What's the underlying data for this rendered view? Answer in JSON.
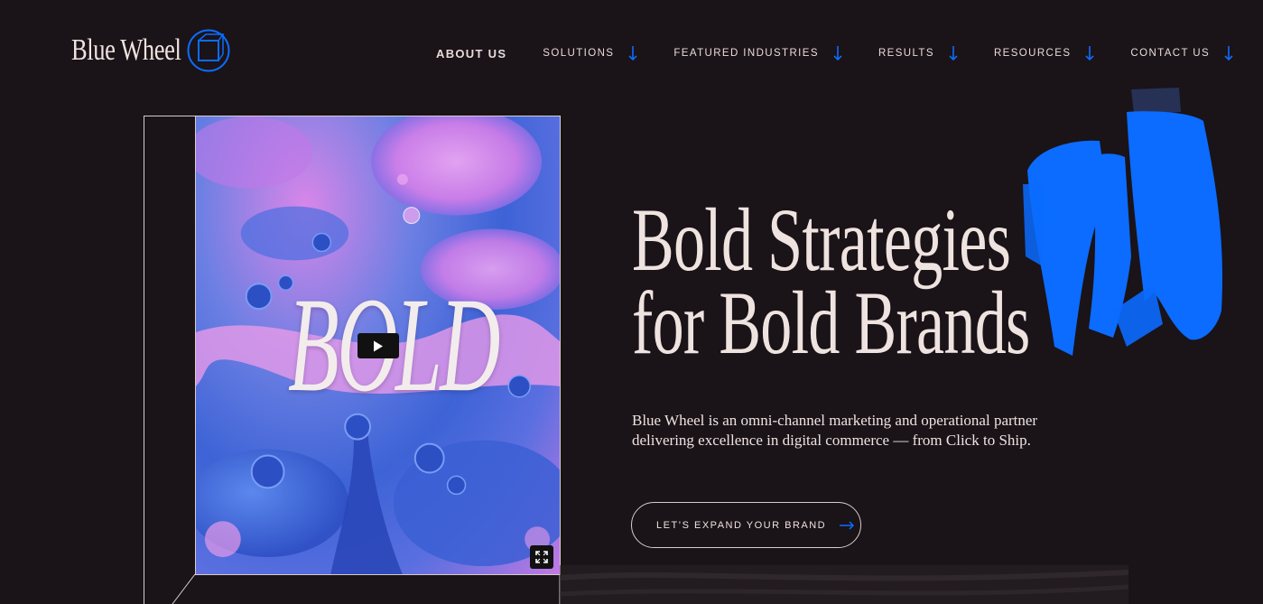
{
  "header": {
    "logo_text": "Blue Wheel",
    "nav": [
      {
        "label": "ABOUT US",
        "has_dropdown": false
      },
      {
        "label": "SOLUTIONS",
        "has_dropdown": true
      },
      {
        "label": "FEATURED INDUSTRIES",
        "has_dropdown": true
      },
      {
        "label": "RESULTS",
        "has_dropdown": true
      },
      {
        "label": "RESOURCES",
        "has_dropdown": true
      },
      {
        "label": "CONTACT US",
        "has_dropdown": true
      }
    ]
  },
  "hero": {
    "video_overlay_text": "BOLD",
    "headline_line1": "Bold Strategies",
    "headline_line2": "for Bold Brands",
    "description": "Blue Wheel is an omni-channel marketing and operational partner delivering excellence in digital commerce — from Click to Ship.",
    "cta_label": "LET’S EXPAND YOUR BRAND"
  },
  "icons": {
    "logo": "wheel-cube-icon",
    "dropdown": "arrow-down-icon",
    "play": "play-icon",
    "expand": "expand-icon",
    "cta": "arrow-right-icon"
  },
  "colors": {
    "background": "#1a1318",
    "text": "#efe3e0",
    "accent_blue": "#0b6cff"
  }
}
